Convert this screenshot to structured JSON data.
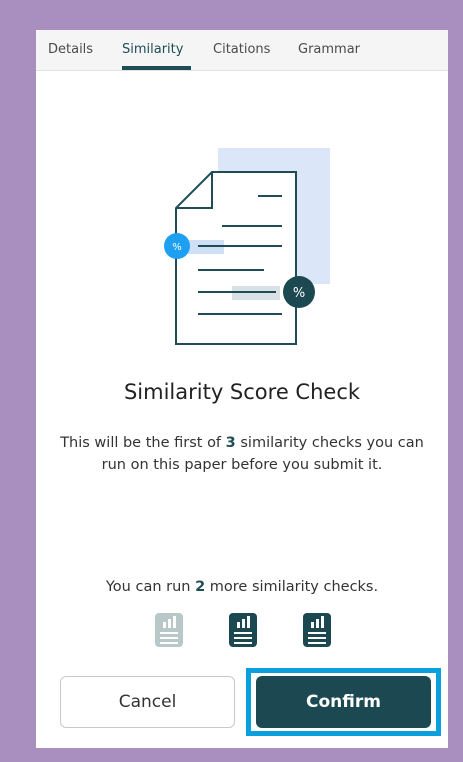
{
  "tabs": [
    {
      "label": "Details"
    },
    {
      "label": "Similarity",
      "active": true
    },
    {
      "label": "Citations"
    },
    {
      "label": "Grammar"
    }
  ],
  "illustration": {
    "badge_small": "%",
    "badge_large": "%"
  },
  "heading": "Similarity Score Check",
  "description": {
    "before": "This will be the first of",
    "count": "3",
    "after": "similarity checks you can run on this paper before you submit it."
  },
  "remaining": {
    "before": "You can run",
    "count": "2",
    "after": "more similarity checks."
  },
  "checks": {
    "total": 3,
    "used": 1,
    "icon": "bar-chart-document-icon"
  },
  "buttons": {
    "cancel": "Cancel",
    "confirm": "Confirm"
  },
  "colors": {
    "accent": "#1c4951",
    "focus_ring": "#0aa0de",
    "badge_blue": "#1da0f2",
    "used_icon": "#b8c8c8"
  }
}
